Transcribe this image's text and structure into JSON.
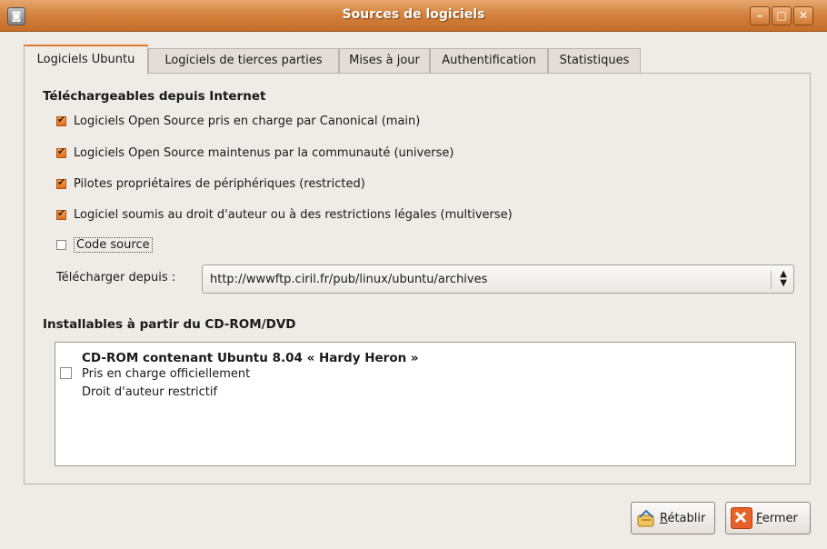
{
  "window": {
    "title": "Sources de logiciels",
    "controls": [
      "minimize-icon",
      "maximize-icon",
      "close-icon"
    ]
  },
  "tabs": [
    {
      "label": "Logiciels Ubuntu"
    },
    {
      "label": "Logiciels de tierces parties"
    },
    {
      "label": "Mises à jour"
    },
    {
      "label": "Authentification"
    },
    {
      "label": "Statistiques"
    }
  ],
  "internet": {
    "title": "Téléchargeables depuis Internet",
    "items": [
      {
        "label": "Logiciels Open Source pris en charge par Canonical (main)",
        "checked": true
      },
      {
        "label": "Logiciels Open Source maintenus par la communauté (universe)",
        "checked": true
      },
      {
        "label": "Pilotes propriétaires de périphériques (restricted)",
        "checked": true
      },
      {
        "label": "Logiciel soumis au droit d'auteur ou à des restrictions légales (multiverse)",
        "checked": true
      },
      {
        "label": "Code source",
        "checked": false
      }
    ],
    "download_label": "Télécharger depuis :",
    "download_value": "http://wwwftp.ciril.fr/pub/linux/ubuntu/archives"
  },
  "cdrom": {
    "title": "Installables à partir du CD-ROM/DVD",
    "entry_title": "CD-ROM contenant Ubuntu 8.04 « Hardy Heron »",
    "entry_line1": "Pris en charge officiellement",
    "entry_line2": "Droit d'auteur restrictif",
    "checked": false
  },
  "buttons": {
    "revert": {
      "mnemonic": "R",
      "rest": "établir",
      "icon": "revert-icon"
    },
    "close": {
      "mnemonic": "F",
      "rest": "ermer",
      "icon": "close-icon"
    }
  },
  "colors": {
    "accent": "#d4833f",
    "checkbox": "#e0701e",
    "close_icon": "#e8612a"
  }
}
